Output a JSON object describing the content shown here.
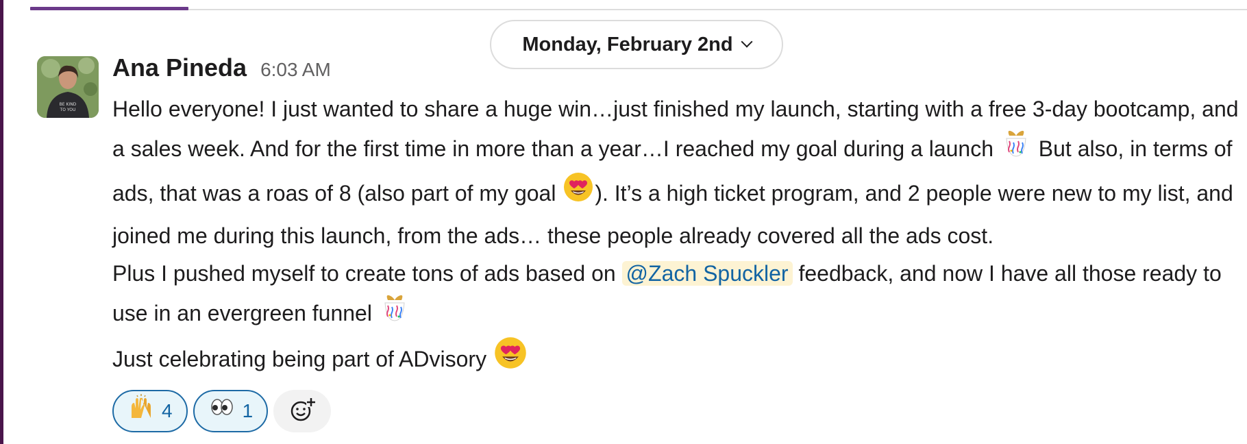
{
  "date_divider": {
    "label": "Monday, February 2nd",
    "icon": "chevron-down-icon"
  },
  "message": {
    "author": "Ana Pineda",
    "timestamp": "6:03 AM",
    "paragraph1": {
      "part1": "Hello everyone! I just wanted to share a huge win…just finished my launch, starting with a free 3-day bootcamp, and a sales week. And for the first time in more than a year…I reached my goal during a launch",
      "part2": " But also, in terms of ads, that was a roas of 8 (also part of my goal",
      "part3": "). It’s a high ticket program, and 2 people were new to my list, and joined me during this launch, from the ads… these people already covered all the ads cost."
    },
    "paragraph2": {
      "before_mention": "Plus I pushed myself to create tons of ads based on ",
      "mention": "@Zach Spuckler",
      "after_mention": " feedback, and now I have all those ready to use in an evergreen funnel "
    },
    "paragraph3": {
      "text": "Just celebrating being part of ADvisory "
    },
    "emojis": [
      "confetti-gift-icon",
      "heart-eyes-icon"
    ]
  },
  "reactions": [
    {
      "emoji": "raised-hands-icon",
      "count": "4"
    },
    {
      "emoji": "eyes-icon",
      "count": "1"
    }
  ],
  "add_reaction": {
    "icon": "add-reaction-icon"
  },
  "colors": {
    "accent_purple": "#4a154b",
    "mention_bg": "#fdf3d3",
    "mention_text": "#1264a3",
    "reaction_border": "#1d6aa5",
    "reaction_bg": "#e8f5fa"
  }
}
